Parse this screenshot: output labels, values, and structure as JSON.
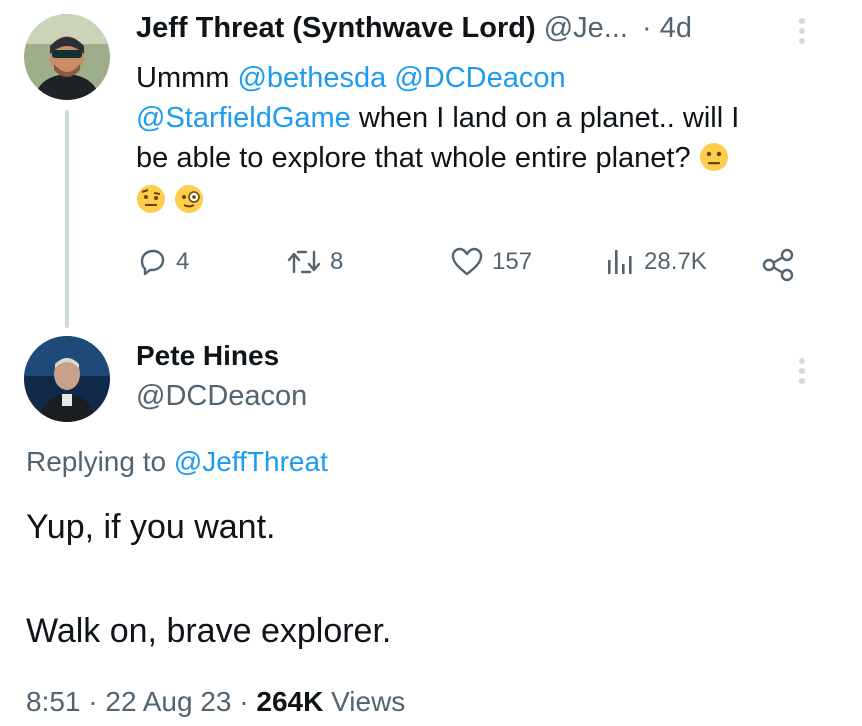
{
  "tweet": {
    "author_name": "Jeff Threat (Synthwave Lord)",
    "handle": "@Je...",
    "time": "· 4d",
    "text_line1_prefix": "Ummm ",
    "mention1": "@bethesda",
    "mention2": "@DCDeacon",
    "mention3": "@StarfieldGame",
    "text_line2": " when I land on a planet.. will I",
    "text_line3": "be able to explore that whole entire planet?",
    "emojis": [
      "neutral-face-emoji",
      "raised-eyebrow-emoji",
      "monocle-face-emoji"
    ],
    "stats": {
      "replies": "4",
      "retweets": "8",
      "likes": "157",
      "views": "28.7K"
    }
  },
  "reply": {
    "author_name": "Pete Hines",
    "handle": "@DCDeacon",
    "replying_prefix": "Replying to ",
    "replying_to": "@JeffThreat",
    "text_line1": "Yup, if you want.",
    "text_line2": "Walk on, brave explorer.",
    "timestamp": "8:51 · 22 Aug 23 · ",
    "views_count": "264K",
    "views_label": " Views"
  },
  "colors": {
    "link": "#1d9bf0",
    "muted": "#536471",
    "text": "#0f1419",
    "thread_line": "#cfd9de"
  }
}
